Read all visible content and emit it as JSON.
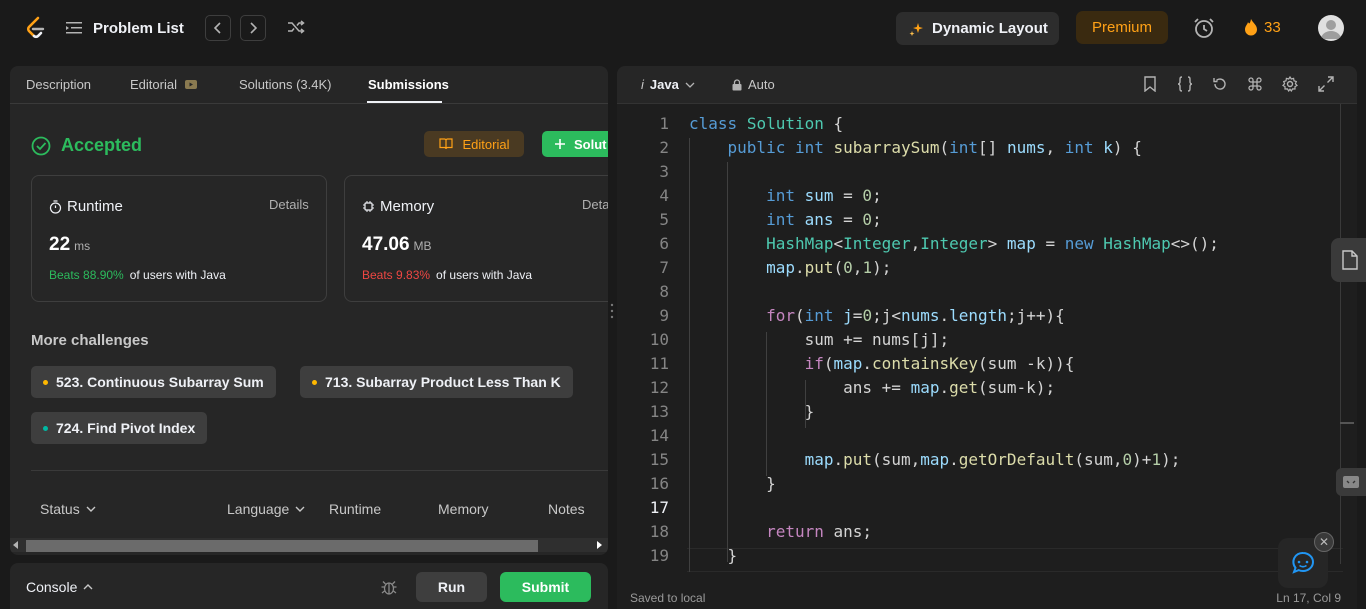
{
  "header": {
    "problem_list_label": "Problem List",
    "dynamic_layout_label": "Dynamic Layout",
    "premium_label": "Premium",
    "streak_count": "33"
  },
  "tabs": [
    {
      "label": "Description"
    },
    {
      "label": "Editorial"
    },
    {
      "label": "Solutions (3.4K)"
    },
    {
      "label": "Submissions"
    }
  ],
  "result": {
    "status": "Accepted",
    "editorial_button": "Editorial",
    "solution_button": "Solut",
    "runtime": {
      "title": "Runtime",
      "details": "Details",
      "value": "22",
      "unit": "ms",
      "beats": "Beats 88.90%",
      "beats_tail": "of users with Java"
    },
    "memory": {
      "title": "Memory",
      "details": "Deta",
      "value": "47.06",
      "unit": "MB",
      "beats": "Beats 9.83%",
      "beats_tail": "of users with Java"
    }
  },
  "more_challenges": {
    "title": "More challenges",
    "items": [
      {
        "label": "523. Continuous Subarray Sum",
        "color": "#ffb800"
      },
      {
        "label": "713. Subarray Product Less Than K",
        "color": "#ffb800"
      },
      {
        "label": "724. Find Pivot Index",
        "color": "#00b8a3"
      }
    ]
  },
  "table_headers": {
    "status": "Status",
    "language": "Language",
    "runtime": "Runtime",
    "memory": "Memory",
    "notes": "Notes"
  },
  "console": {
    "label": "Console",
    "run": "Run",
    "submit": "Submit"
  },
  "editor": {
    "language": "Java",
    "language_prefix": "i",
    "mode": "Auto",
    "saved_status": "Saved to local",
    "cursor_position": "Ln 17, Col 9",
    "current_line": 17
  },
  "colors": {
    "accent_green": "#2cbb5d",
    "accent_orange": "#ffa116",
    "accent_red": "#ef4743"
  }
}
